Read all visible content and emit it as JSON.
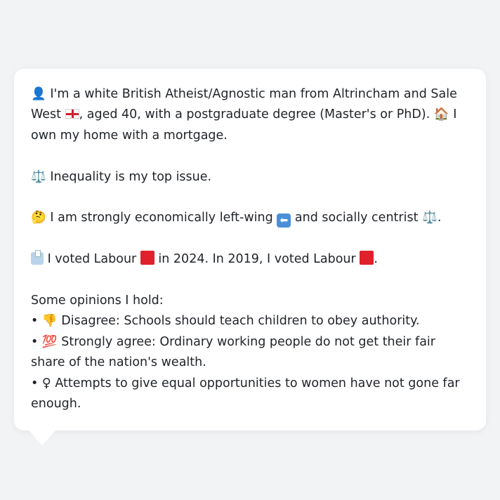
{
  "profile": {
    "intro_a": "I'm a white British Atheist/Agnostic man from Altrincham and Sale West",
    "intro_b": ", aged 40, with a postgraduate degree (Master's or PhD).",
    "intro_c": "I own my home with a mortgage.",
    "issue": "Inequality is my top issue.",
    "ideology_a": "I am strongly economically left-wing",
    "ideology_b": "and socially centrist",
    "ideology_c": ".",
    "vote_a": "I voted Labour",
    "vote_b": "in 2024. In 2019, I voted Labour",
    "vote_c": ".",
    "opinions_heading": "Some opinions I hold:",
    "opinions": [
      {
        "bullet": "•",
        "emoji": "👎",
        "text": "Disagree: Schools should teach children to obey authority."
      },
      {
        "bullet": "•",
        "emoji": "💯",
        "text": "Strongly agree: Ordinary working people do not get their fair share of the nation's wealth."
      },
      {
        "bullet": "•",
        "emoji": "♀",
        "text": "Attempts to give equal opportunities to women have not gone far enough."
      }
    ]
  },
  "icons": {
    "person": "👤",
    "house": "🏠",
    "scales": "⚖️",
    "thinking": "🤔",
    "left_arrow": "⬅",
    "ballot": "🗳"
  },
  "colors": {
    "labour_red": "#e0212b",
    "background": "#f1f3f5",
    "card": "#ffffff",
    "text": "#1f2328"
  }
}
